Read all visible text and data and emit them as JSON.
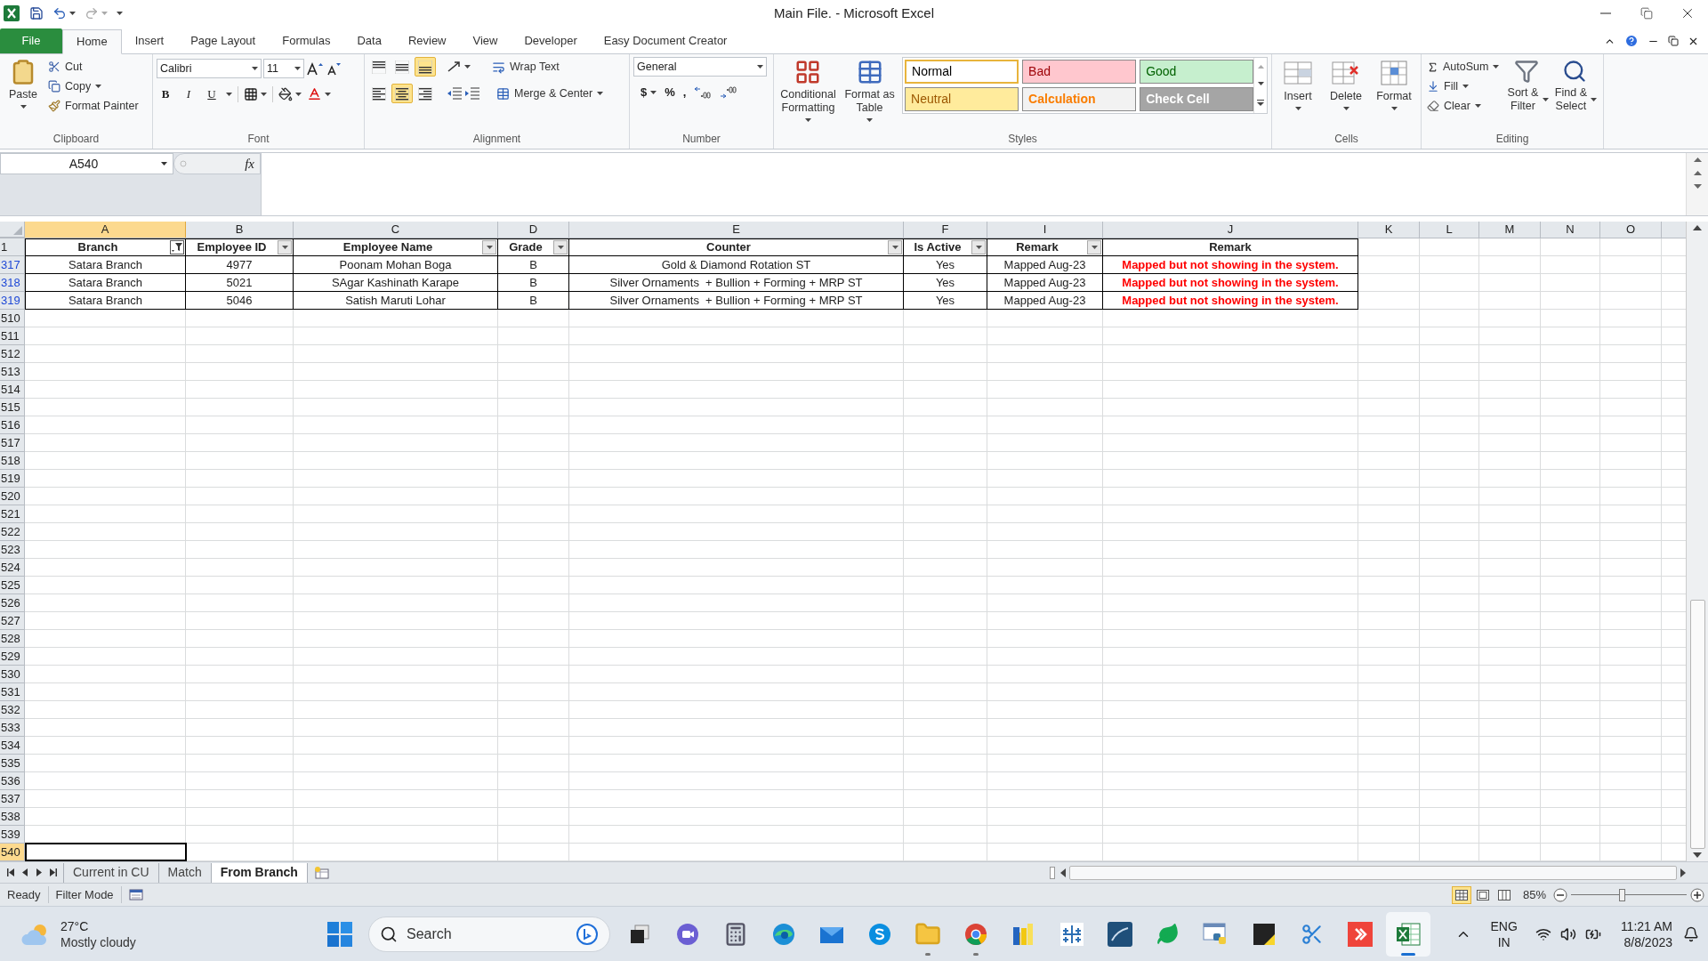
{
  "window": {
    "title": "Main File.  - Microsoft Excel"
  },
  "ribbon_tabs": [
    {
      "label": "File",
      "kind": "file",
      "selected": false
    },
    {
      "label": "Home",
      "kind": "tab",
      "selected": true
    },
    {
      "label": "Insert",
      "kind": "tab",
      "selected": false
    },
    {
      "label": "Page Layout",
      "kind": "tab",
      "selected": false
    },
    {
      "label": "Formulas",
      "kind": "tab",
      "selected": false
    },
    {
      "label": "Data",
      "kind": "tab",
      "selected": false
    },
    {
      "label": "Review",
      "kind": "tab",
      "selected": false
    },
    {
      "label": "View",
      "kind": "tab",
      "selected": false
    },
    {
      "label": "Developer",
      "kind": "tab",
      "selected": false
    },
    {
      "label": "Easy Document Creator",
      "kind": "tab",
      "selected": false
    }
  ],
  "clipboard": {
    "label": "Clipboard",
    "paste": "Paste",
    "cut": "Cut",
    "copy": "Copy",
    "format_painter": "Format Painter"
  },
  "font": {
    "label": "Font",
    "name": "Calibri",
    "size": "11",
    "bold": "B",
    "italic": "I",
    "underline": "U"
  },
  "alignment": {
    "label": "Alignment",
    "wrap_text": "Wrap Text",
    "merge": "Merge & Center",
    "vertical_align_buttons": [
      {
        "selected": false
      },
      {
        "selected": false
      },
      {
        "selected": true
      }
    ],
    "horizontal_align_buttons": [
      {
        "selected": false
      },
      {
        "selected": true
      },
      {
        "selected": false
      }
    ]
  },
  "number": {
    "label": "Number",
    "format": "General",
    "currency": "$",
    "percent": "%",
    "comma": ","
  },
  "styles": {
    "label": "Styles",
    "conditional": "Conditional Formatting",
    "table": "Format as Table",
    "gallery": [
      {
        "text": "Normal",
        "color": "#ffffff",
        "selected": true
      },
      {
        "text": "Bad",
        "color": "#ffc7ce",
        "selected": false
      },
      {
        "text": "Good",
        "color": "#c6efce",
        "selected": false
      },
      {
        "text": "Neutral",
        "color": "#ffeb9c",
        "selected": false
      },
      {
        "text": "Calculation",
        "color": "#f2f2f2",
        "selected": false
      },
      {
        "text": "Check Cell",
        "color": "#a5a5a5",
        "selected": false
      }
    ]
  },
  "cells": {
    "label": "Cells",
    "buttons": [
      "Insert",
      "Delete",
      "Format"
    ]
  },
  "editing": {
    "label": "Editing",
    "autosum": "AutoSum",
    "fill": "Fill",
    "clear": "Clear",
    "sort": "Sort & Filter",
    "find": "Find & Select"
  },
  "formula_bar": {
    "name_box": "A540",
    "function_symbol": "fx"
  },
  "sheet": {
    "columns": [
      {
        "letter": "A",
        "selected": true
      },
      {
        "letter": "B",
        "selected": false
      },
      {
        "letter": "C",
        "selected": false
      },
      {
        "letter": "D",
        "selected": false
      },
      {
        "letter": "E",
        "selected": false
      },
      {
        "letter": "F",
        "selected": false
      },
      {
        "letter": "I",
        "selected": false
      },
      {
        "letter": "J",
        "selected": false
      },
      {
        "letter": "K",
        "selected": false
      },
      {
        "letter": "L",
        "selected": false
      },
      {
        "letter": "M",
        "selected": false
      },
      {
        "letter": "N",
        "selected": false
      },
      {
        "letter": "O",
        "selected": false
      }
    ],
    "header_row_number": "1",
    "header": [
      {
        "text": "Branch",
        "filter_button": true,
        "filter_applied": true
      },
      {
        "text": "Employee ID",
        "filter_button": true,
        "filter_applied": false
      },
      {
        "text": "Employee Name",
        "filter_button": true,
        "filter_applied": false
      },
      {
        "text": "Grade",
        "filter_button": true,
        "filter_applied": false
      },
      {
        "text": "Counter",
        "filter_button": true,
        "filter_applied": false
      },
      {
        "text": "Is Active",
        "filter_button": true,
        "filter_applied": false
      },
      {
        "text": "Remark",
        "filter_button": true,
        "filter_applied": false
      },
      {
        "text": "Remark",
        "filter_button": false
      }
    ],
    "rows": [
      {
        "number": "317",
        "filtered": true,
        "cells": [
          "Satara Branch",
          "4977",
          "Poonam Mohan Boga",
          "B",
          "Gold & Diamond Rotation ST",
          "Yes",
          "Mapped Aug-23",
          "Mapped but not showing in the system."
        ]
      },
      {
        "number": "318",
        "filtered": true,
        "cells": [
          "Satara Branch",
          "5021",
          "SAgar Kashinath Karape",
          "B",
          "Silver Ornaments  + Bullion + Forming + MRP ST",
          "Yes",
          "Mapped Aug-23",
          "Mapped but not showing in the system."
        ]
      },
      {
        "number": "319",
        "filtered": true,
        "cells": [
          "Satara Branch",
          "5046",
          "Satish Maruti Lohar",
          "B",
          "Silver Ornaments  + Bullion + Forming + MRP ST",
          "Yes",
          "Mapped Aug-23",
          "Mapped but not showing in the system."
        ]
      }
    ],
    "empty_rows": [
      {
        "number": "510",
        "selected": false
      },
      {
        "number": "511",
        "selected": false
      },
      {
        "number": "512",
        "selected": false
      },
      {
        "number": "513",
        "selected": false
      },
      {
        "number": "514",
        "selected": false
      },
      {
        "number": "515",
        "selected": false
      },
      {
        "number": "516",
        "selected": false
      },
      {
        "number": "517",
        "selected": false
      },
      {
        "number": "518",
        "selected": false
      },
      {
        "number": "519",
        "selected": false
      },
      {
        "number": "520",
        "selected": false
      },
      {
        "number": "521",
        "selected": false
      },
      {
        "number": "522",
        "selected": false
      },
      {
        "number": "523",
        "selected": false
      },
      {
        "number": "524",
        "selected": false
      },
      {
        "number": "525",
        "selected": false
      },
      {
        "number": "526",
        "selected": false
      },
      {
        "number": "527",
        "selected": false
      },
      {
        "number": "528",
        "selected": false
      },
      {
        "number": "529",
        "selected": false
      },
      {
        "number": "530",
        "selected": false
      },
      {
        "number": "531",
        "selected": false
      },
      {
        "number": "532",
        "selected": false
      },
      {
        "number": "533",
        "selected": false
      },
      {
        "number": "534",
        "selected": false
      },
      {
        "number": "535",
        "selected": false
      },
      {
        "number": "536",
        "selected": false
      },
      {
        "number": "537",
        "selected": false
      },
      {
        "number": "538",
        "selected": false
      },
      {
        "number": "539",
        "selected": false
      },
      {
        "number": "540",
        "selected": true
      }
    ]
  },
  "sheet_tabs": [
    {
      "label": "Current in CU",
      "selected": false
    },
    {
      "label": "Match",
      "selected": false
    },
    {
      "label": "From Branch",
      "selected": true
    }
  ],
  "status_bar": {
    "items": [
      "Ready",
      "Filter Mode"
    ],
    "view_buttons": [
      {
        "selected": true
      },
      {
        "selected": false
      },
      {
        "selected": false
      }
    ],
    "zoom": {
      "reading": "85%",
      "level": 0.44
    }
  },
  "taskbar": {
    "weather": {
      "temperature": "27°C",
      "condition": "Mostly cloudy"
    },
    "search": {
      "label": "Search"
    },
    "apps": [
      {
        "kind": "taskview",
        "running": false,
        "active": false
      },
      {
        "kind": "video",
        "running": false,
        "active": false
      },
      {
        "kind": "calculator",
        "running": false,
        "active": false
      },
      {
        "kind": "edge",
        "running": false,
        "active": false
      },
      {
        "kind": "mail",
        "running": false,
        "active": false
      },
      {
        "kind": "skype",
        "running": false,
        "active": false
      },
      {
        "kind": "folder",
        "running": true,
        "active": false
      },
      {
        "kind": "chrome",
        "running": true,
        "active": false
      },
      {
        "kind": "chart",
        "running": false,
        "active": false
      },
      {
        "kind": "tableau",
        "running": false,
        "active": false
      },
      {
        "kind": "database",
        "running": false,
        "active": false
      },
      {
        "kind": "leaf",
        "running": false,
        "active": false
      },
      {
        "kind": "python",
        "running": false,
        "active": false
      },
      {
        "kind": "sticky",
        "running": false,
        "active": false
      },
      {
        "kind": "snip",
        "running": false,
        "active": false
      },
      {
        "kind": "remote",
        "running": false,
        "active": false
      },
      {
        "kind": "excel",
        "running": true,
        "active": true
      }
    ],
    "language": "ENG",
    "region": "IN",
    "time": "11:21 AM",
    "date": "8/8/2023"
  }
}
